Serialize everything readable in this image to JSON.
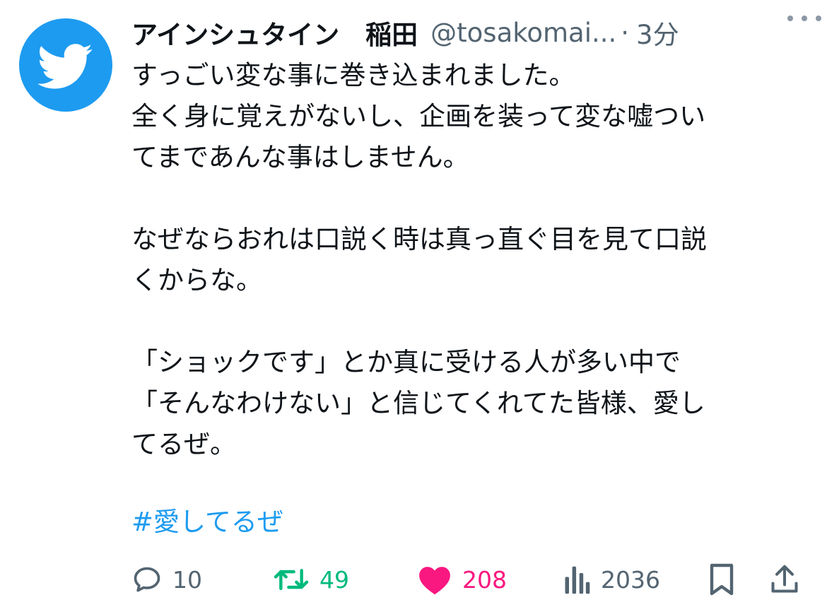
{
  "author": {
    "display_name": "アインシュタイン　稲田",
    "handle": "@tosakomai...",
    "separator": "·",
    "time": "3分"
  },
  "tweet": {
    "paragraphs": [
      [
        "すっごい変な事に巻き込まれました。",
        "全く身に覚えがないし、企画を装って変な嘘つい",
        "てまであんな事はしません。"
      ],
      [
        "なぜならおれは口説く時は真っ直ぐ目を見て口説",
        "くからな。"
      ],
      [
        "「ショックです」とか真に受ける人が多い中で",
        "「そんなわけない」と信じてくれてた皆様、愛し",
        "てるぜ。"
      ]
    ],
    "hashtag": "#愛してるぜ"
  },
  "actions": {
    "reply_count": "10",
    "retweet_count": "49",
    "like_count": "208",
    "view_count": "2036"
  },
  "colors": {
    "accent": "#1d9bf0",
    "retweet": "#00ba7c",
    "like": "#f91880",
    "muted": "#536471"
  },
  "icons": {
    "avatar": "twitter-bird-icon",
    "more": "more-dots-icon",
    "reply": "reply-bubble-icon",
    "retweet": "retweet-icon",
    "like": "heart-filled-icon",
    "views": "views-bar-chart-icon",
    "bookmark": "bookmark-icon",
    "share": "share-upload-icon"
  }
}
